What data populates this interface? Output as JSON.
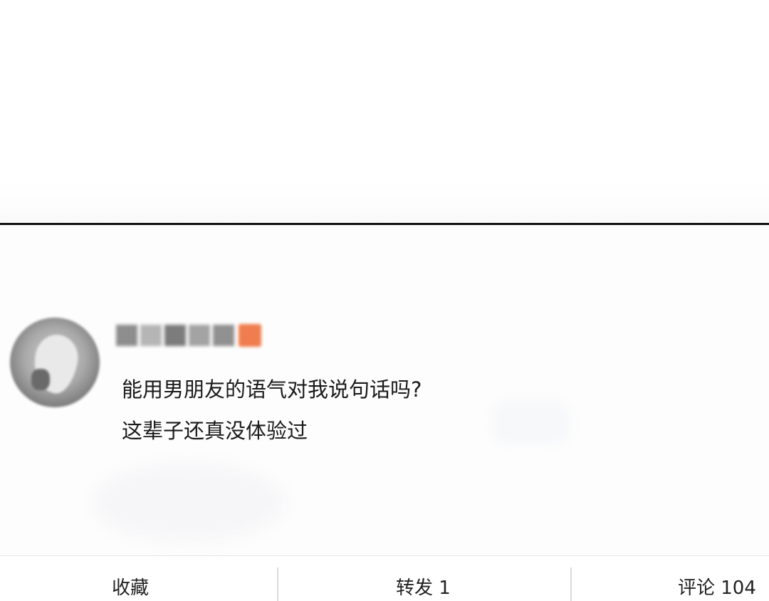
{
  "comment": {
    "lines": [
      "能用男朋友的语气对我说句话吗?",
      "这辈子还真没体验过"
    ]
  },
  "actions": {
    "favorite_label": "收藏",
    "share_label": "转发 1",
    "comment_label": "评论 104"
  },
  "colors": {
    "divider": "#111111",
    "badge": "#f07d4f",
    "text": "#1a1a1a"
  }
}
